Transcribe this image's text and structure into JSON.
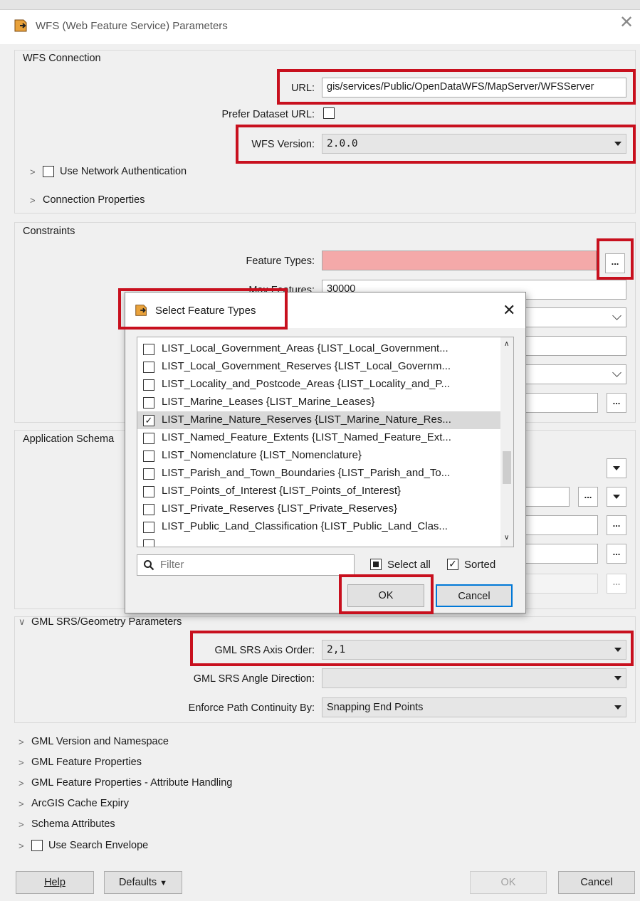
{
  "window": {
    "title": "WFS (Web Feature Service) Parameters"
  },
  "wfs_connection": {
    "title": "WFS Connection",
    "url_label": "URL:",
    "url_value": "gis/services/Public/OpenDataWFS/MapServer/WFSServer",
    "prefer_label": "Prefer Dataset URL:",
    "version_label": "WFS Version:",
    "version_value": "2.0.0",
    "network_auth_label": "Use Network Authentication",
    "conn_props_label": "Connection Properties"
  },
  "constraints": {
    "title": "Constraints",
    "feature_types_label": "Feature Types:",
    "feature_types_value": "",
    "max_features_label": "Max Features:",
    "max_features_value": "30000",
    "dots": "..."
  },
  "app_schema": {
    "title": "Application Schema"
  },
  "gml_srs": {
    "title": "GML SRS/Geometry Parameters",
    "axis_order_label": "GML SRS Axis Order:",
    "axis_order_value": "2,1",
    "angle_label": "GML SRS Angle Direction:",
    "angle_value": "",
    "continuity_label": "Enforce Path Continuity By:",
    "continuity_value": "Snapping End Points"
  },
  "sections": [
    "GML Version and Namespace",
    "GML Feature Properties",
    "GML Feature Properties - Attribute Handling",
    "ArcGIS Cache Expiry",
    "Schema Attributes",
    "Use Search Envelope"
  ],
  "bottom": {
    "help": "Help",
    "defaults": "Defaults",
    "ok": "OK",
    "cancel": "Cancel"
  },
  "dialog": {
    "title": "Select Feature Types",
    "items": [
      {
        "label": "LIST_Local_Government_Areas {LIST_Local_Government...",
        "checked": false
      },
      {
        "label": "LIST_Local_Government_Reserves {LIST_Local_Governm...",
        "checked": false
      },
      {
        "label": "LIST_Locality_and_Postcode_Areas {LIST_Locality_and_P...",
        "checked": false
      },
      {
        "label": "LIST_Marine_Leases {LIST_Marine_Leases}",
        "checked": false
      },
      {
        "label": "LIST_Marine_Nature_Reserves {LIST_Marine_Nature_Res...",
        "checked": true
      },
      {
        "label": "LIST_Named_Feature_Extents {LIST_Named_Feature_Ext...",
        "checked": false
      },
      {
        "label": "LIST_Nomenclature {LIST_Nomenclature}",
        "checked": false
      },
      {
        "label": "LIST_Parish_and_Town_Boundaries {LIST_Parish_and_To...",
        "checked": false
      },
      {
        "label": "LIST_Points_of_Interest {LIST_Points_of_Interest}",
        "checked": false
      },
      {
        "label": "LIST_Private_Reserves {LIST_Private_Reserves}",
        "checked": false
      },
      {
        "label": "LIST_Public_Land_Classification {LIST_Public_Land_Clas...",
        "checked": false
      }
    ],
    "filter_placeholder": "Filter",
    "select_all_label": "Select all",
    "sorted_label": "Sorted",
    "ok": "OK",
    "cancel": "Cancel"
  },
  "colors": {
    "highlight": "#c8101e",
    "error_field": "#f4a9a9",
    "primary_border": "#0078d7"
  }
}
